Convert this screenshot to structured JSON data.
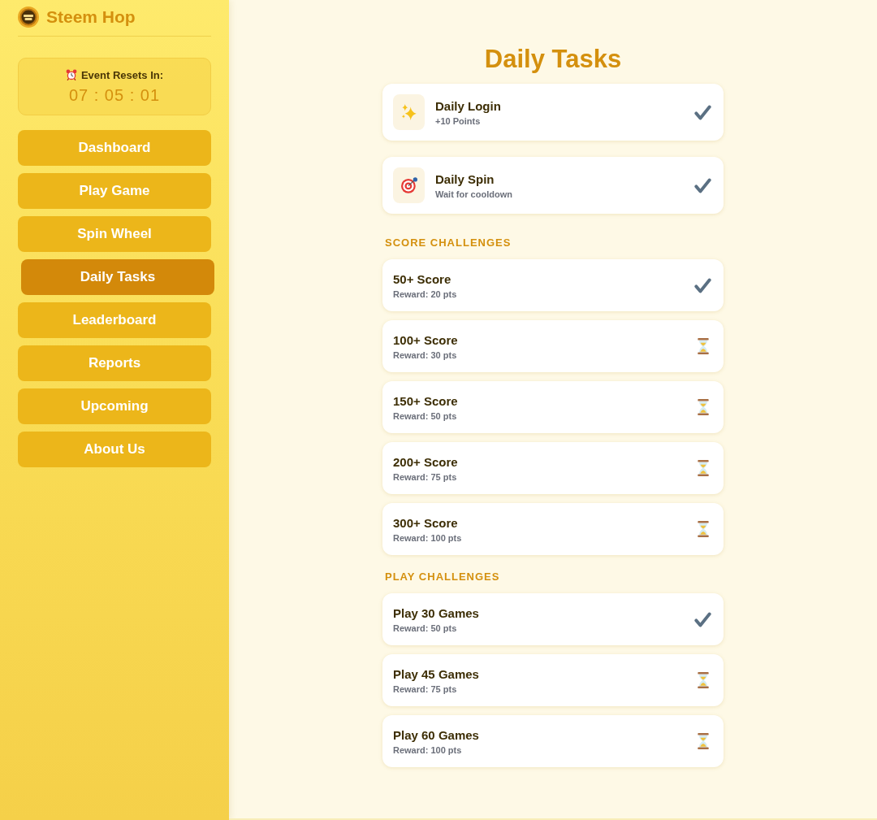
{
  "sidebar": {
    "logo": {
      "text": "Steem Hop"
    },
    "timer": {
      "label": "Event Resets In:",
      "value": "07 : 05 : 01"
    },
    "nav": [
      {
        "label": "Dashboard",
        "selected": false
      },
      {
        "label": "Play Game",
        "selected": false
      },
      {
        "label": "Spin Wheel",
        "selected": false
      },
      {
        "label": "Daily Tasks",
        "selected": true
      },
      {
        "label": "Leaderboard",
        "selected": false
      },
      {
        "label": "Reports",
        "selected": false
      },
      {
        "label": "Upcoming",
        "selected": false
      },
      {
        "label": "About Us",
        "selected": false
      }
    ]
  },
  "main": {
    "title": "Daily Tasks",
    "daily_tasks": [
      {
        "kind": "login",
        "title": "Daily Login",
        "subtitle": "+10 Points",
        "completed": true
      },
      {
        "kind": "spin",
        "title": "Daily Spin",
        "subtitle": "Wait for cooldown",
        "completed": true
      }
    ],
    "sections": [
      {
        "heading": "SCORE CHALLENGES",
        "challenges": [
          {
            "title": "50+ Score",
            "reward": "Reward: 20 pts",
            "completed": true
          },
          {
            "title": "100+ Score",
            "reward": "Reward: 30 pts",
            "completed": false
          },
          {
            "title": "150+ Score",
            "reward": "Reward: 50 pts",
            "completed": false
          },
          {
            "title": "200+ Score",
            "reward": "Reward: 75 pts",
            "completed": false
          },
          {
            "title": "300+ Score",
            "reward": "Reward: 100 pts",
            "completed": false
          }
        ]
      },
      {
        "heading": "PLAY CHALLENGES",
        "challenges": [
          {
            "title": "Play 30 Games",
            "reward": "Reward: 50 pts",
            "completed": true
          },
          {
            "title": "Play 45 Games",
            "reward": "Reward: 75 pts",
            "completed": false
          },
          {
            "title": "Play 60 Games",
            "reward": "Reward: 100 pts",
            "completed": false
          }
        ]
      }
    ]
  }
}
